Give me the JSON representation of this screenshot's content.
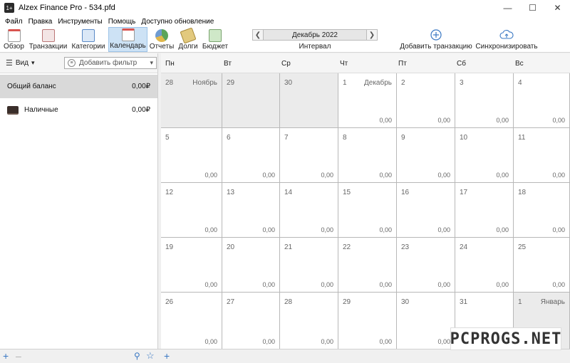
{
  "window": {
    "title": "Alzex Finance Pro - 534.pfd",
    "app_icon": "1+"
  },
  "menu": [
    "Файл",
    "Правка",
    "Инструменты",
    "Помощь",
    "Доступно обновление"
  ],
  "toolbar": {
    "overview": "Обзор",
    "transactions": "Транзакции",
    "categories": "Категории",
    "calendar": "Календарь",
    "reports": "Отчеты",
    "debts": "Долги",
    "budget": "Бюджет",
    "interval_value": "Декабрь 2022",
    "interval_label": "Интервал",
    "add_transaction": "Добавить транзакцию",
    "sync": "Синхронизировать"
  },
  "left": {
    "view_label": "Вид",
    "filter_placeholder": "Добавить фильтр",
    "accounts": [
      {
        "name": "Общий баланс",
        "amount": "0,00₽"
      },
      {
        "name": "Наличные",
        "amount": "0,00₽"
      }
    ]
  },
  "calendar": {
    "weekdays": [
      "Пн",
      "Вт",
      "Ср",
      "Чт",
      "Пт",
      "Сб",
      "Вс"
    ],
    "amount": "0,00",
    "cells": [
      {
        "day": "28",
        "month": "Ноябрь",
        "other": true,
        "amount": ""
      },
      {
        "day": "29",
        "other": true,
        "amount": ""
      },
      {
        "day": "30",
        "other": true,
        "amount": ""
      },
      {
        "day": "1",
        "month": "Декабрь",
        "amount": "0,00"
      },
      {
        "day": "2",
        "amount": "0,00"
      },
      {
        "day": "3",
        "amount": "0,00"
      },
      {
        "day": "4",
        "amount": "0,00"
      },
      {
        "day": "5",
        "amount": "0,00"
      },
      {
        "day": "6",
        "amount": "0,00"
      },
      {
        "day": "7",
        "amount": "0,00"
      },
      {
        "day": "8",
        "amount": "0,00"
      },
      {
        "day": "9",
        "amount": "0,00"
      },
      {
        "day": "10",
        "amount": "0,00"
      },
      {
        "day": "11",
        "amount": "0,00"
      },
      {
        "day": "12",
        "amount": "0,00"
      },
      {
        "day": "13",
        "amount": "0,00"
      },
      {
        "day": "14",
        "amount": "0,00"
      },
      {
        "day": "15",
        "amount": "0,00"
      },
      {
        "day": "16",
        "amount": "0,00"
      },
      {
        "day": "17",
        "amount": "0,00"
      },
      {
        "day": "18",
        "amount": "0,00"
      },
      {
        "day": "19",
        "amount": "0,00"
      },
      {
        "day": "20",
        "amount": "0,00"
      },
      {
        "day": "21",
        "amount": "0,00"
      },
      {
        "day": "22",
        "amount": "0,00"
      },
      {
        "day": "23",
        "amount": "0,00"
      },
      {
        "day": "24",
        "amount": "0,00"
      },
      {
        "day": "25",
        "amount": "0,00"
      },
      {
        "day": "26",
        "amount": "0,00"
      },
      {
        "day": "27",
        "amount": "0,00"
      },
      {
        "day": "28",
        "amount": "0,00"
      },
      {
        "day": "29",
        "amount": "0,00"
      },
      {
        "day": "30",
        "amount": "0,00"
      },
      {
        "day": "31",
        "amount": "0,00"
      },
      {
        "day": "1",
        "month": "Январь",
        "other": true,
        "amount": ""
      }
    ]
  },
  "watermark": "PCPROGS.NET",
  "colors": {
    "accent": "#3a78c3",
    "selected": "#cde2f5",
    "other_month": "#ebebeb"
  }
}
